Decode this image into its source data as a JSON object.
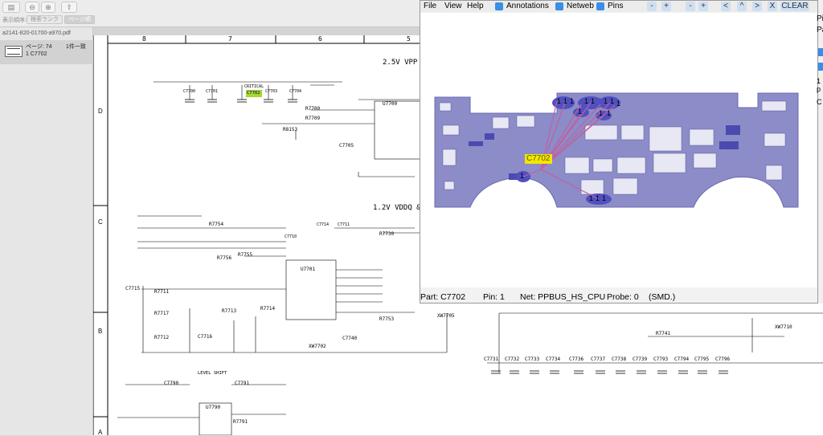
{
  "toolbar": {
    "display_order_label": "表示順序:",
    "tab_page_thumbnail": "検索ランク",
    "tab_page_order": "ページ順",
    "zoom_out_icon": "zoom-out-icon",
    "zoom_in_icon": "zoom-in-icon",
    "share_icon": "share-icon",
    "sidebar_icon": "sidebar-icon"
  },
  "sidebar": {
    "filename": "a2141-820-01700-a970.pdf",
    "result_page": "ページ: 74",
    "result_count": "1件一致",
    "result_text": "1 C7702"
  },
  "schematic": {
    "col_numbers": [
      "8",
      "7",
      "6",
      "5"
    ],
    "row_letters": [
      "D",
      "C",
      "B",
      "A"
    ],
    "title_vpp": "2.5V VPP",
    "title_vddq": "1.2V VDDQ &",
    "refs": {
      "c7702": "C7702",
      "c7700": "C7700",
      "c7701": "C7701",
      "c7703": "C7703",
      "c7704": "C7704",
      "r7700": "R7700",
      "r7709": "R7709",
      "r8153": "R8153",
      "c7705": "C7705",
      "u7700": "U7700",
      "critical": "CRITICAL",
      "r7754": "R7754",
      "c7714": "C7714",
      "c7711": "C7711",
      "r7730": "R7730",
      "c7710": "C7710",
      "r7755": "R7755",
      "r7756": "R7756",
      "u7701": "U7701",
      "c7715": "C7715",
      "r7711": "R7711",
      "r7717": "R7717",
      "r7713": "R7713",
      "r7714": "R7714",
      "r7712": "R7712",
      "c7716": "C7716",
      "c7740": "C7740",
      "xw7702": "XW7702",
      "r7753": "R7753",
      "xw7705": "XW7705",
      "r7741": "R7741",
      "xw7710": "XW7710",
      "c7790": "C7790",
      "c7791": "C7791",
      "u7790": "U7790",
      "level_shift": "LEVEL SHIFT",
      "r7791": "R7791",
      "cap_bank": [
        "C7731",
        "C7732",
        "C7733",
        "C7734",
        "C7736",
        "C7737",
        "C7738",
        "C7739",
        "C7793",
        "C7794",
        "C7795",
        "C7796"
      ]
    }
  },
  "viewer": {
    "menu": [
      "File",
      "View",
      "Help"
    ],
    "toggle_annotations": "Annotations",
    "toggle_netweb": "Netweb",
    "toggle_pins": "Pins",
    "btn_minus1": "-",
    "btn_plus1": "+",
    "btn_minus2": "-",
    "btn_plus2": "+",
    "btn_left": "<",
    "btn_up": "^",
    "btn_right": ">",
    "btn_close": "X",
    "btn_clear": "CLEAR",
    "highlight_label": "C7702",
    "pin_labels": [
      "1",
      "1",
      "1",
      "1",
      "1",
      "1",
      "1",
      "1",
      "1",
      "1",
      "1",
      "1",
      "1",
      "1",
      "1",
      "1",
      "1",
      "1"
    ],
    "status_part": "Part: C7702",
    "status_pin": "Pin: 1",
    "status_net": "Net: PPBUS_HS_CPU",
    "status_probe": "Probe: 0",
    "status_smd": "(SMD.)",
    "accent": "#3a8ee6",
    "board_color": "#8c8cc8",
    "highlight_color": "#f5e600",
    "netline_color": "#c060a0"
  },
  "right_panel": {
    "label_pi": "Pi",
    "label_pa": "Pa",
    "label_1p": "1 p",
    "label_c": "C"
  }
}
